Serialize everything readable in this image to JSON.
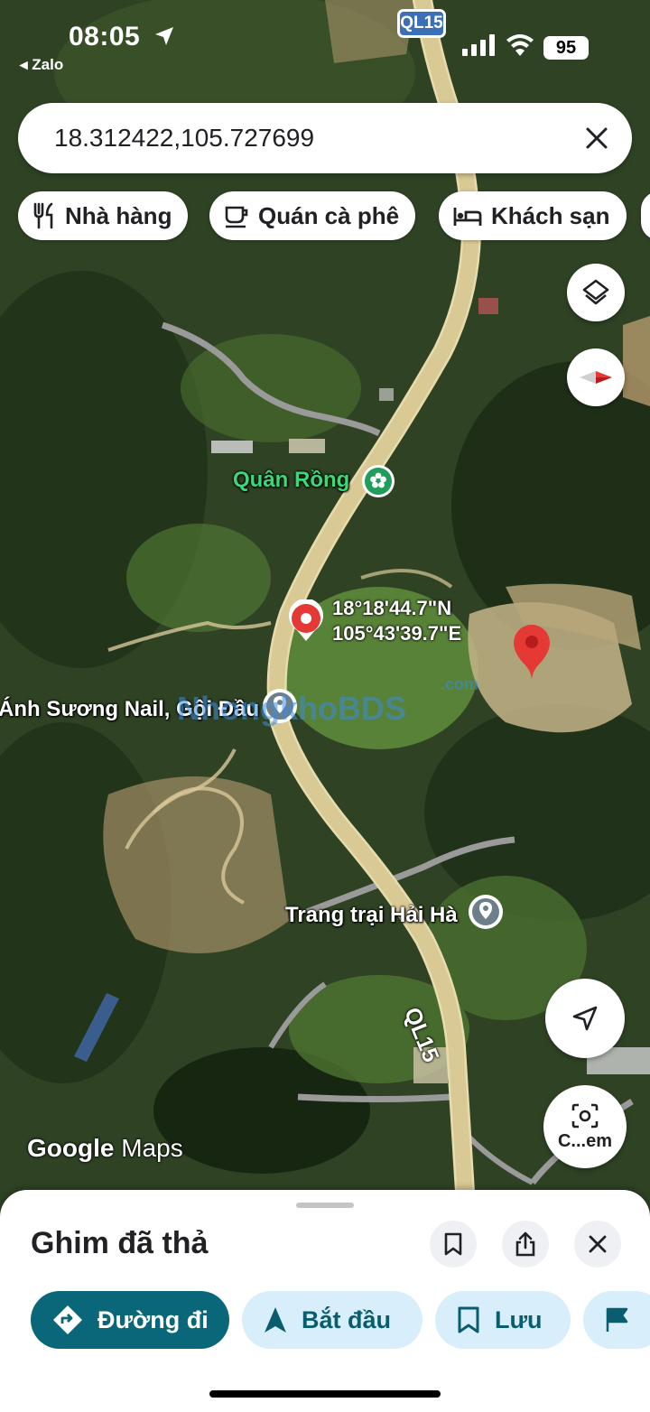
{
  "status_bar": {
    "time": "08:05",
    "back_app": "◂ Zalo",
    "battery": "95"
  },
  "search": {
    "value": "18.312422,105.727699"
  },
  "chips": [
    {
      "label": "Nhà hàng",
      "icon": "fork-knife-icon"
    },
    {
      "label": "Quán cà phê",
      "icon": "coffee-cup-icon"
    },
    {
      "label": "Khách sạn",
      "icon": "bed-icon"
    }
  ],
  "map": {
    "road_shields": [
      "QL15",
      "QL15"
    ],
    "places": {
      "quan_rong": "Quân Rồng",
      "anh_suong": "Ánh Sương Nail, Gội Đầu",
      "trang_trai": "Trang trại Hải Hà"
    },
    "coords": {
      "lat": "18°18'44.7\"N",
      "lng": "105°43'39.7\"E"
    },
    "watermark": {
      "text": "NhongkhoBDS",
      "com": ".com"
    },
    "attribution": {
      "google": "Google",
      "maps": "Maps"
    },
    "colors": {
      "pin": "#e53935",
      "road": "#d9c995",
      "place_green": "#3fd67a"
    }
  },
  "fabs": {
    "layers_icon": "layers-icon",
    "compass_icon": "compass-icon",
    "location_icon": "navigation-arrow-icon",
    "lens_label": "C...em"
  },
  "sheet": {
    "title": "Ghim đã thả",
    "actions": [
      {
        "label": "Đường đi",
        "icon": "directions-icon"
      },
      {
        "label": "Bắt đầu",
        "icon": "navigation-icon"
      },
      {
        "label": "Lưu",
        "icon": "bookmark-icon"
      },
      {
        "label": "",
        "icon": "flag-icon"
      }
    ]
  }
}
